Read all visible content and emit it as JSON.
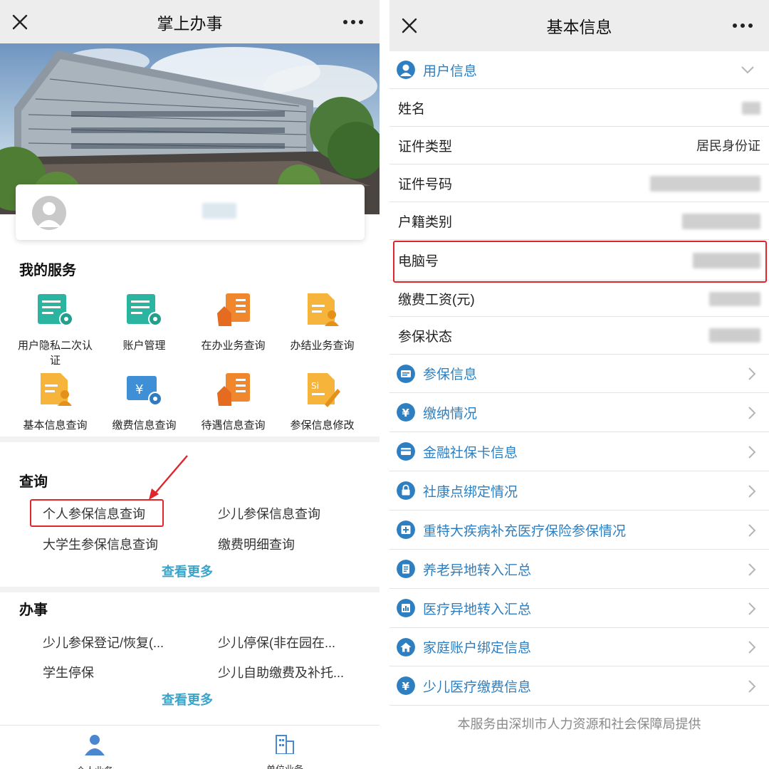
{
  "left": {
    "title": "掌上办事",
    "services_title": "我的服务",
    "services": [
      {
        "label": "用户隐私二次认证",
        "icon": "document-gear-icon"
      },
      {
        "label": "账户管理",
        "icon": "document-gear-icon"
      },
      {
        "label": "在办业务查询",
        "icon": "hand-checklist-icon"
      },
      {
        "label": "办结业务查询",
        "icon": "document-person-icon"
      },
      {
        "label": "基本信息查询",
        "icon": "document-person-icon"
      },
      {
        "label": "缴费信息查询",
        "icon": "yen-card-gear-icon"
      },
      {
        "label": "待遇信息查询",
        "icon": "hand-checklist-icon"
      },
      {
        "label": "参保信息修改",
        "icon": "si-document-pen-icon"
      }
    ],
    "query": {
      "title": "查询",
      "links": [
        "个人参保信息查询",
        "少儿参保信息查询",
        "大学生参保信息查询",
        "缴费明细查询"
      ],
      "more": "查看更多"
    },
    "affairs": {
      "title": "办事",
      "links": [
        "少儿参保登记/恢复(...",
        "少儿停保(非在园在...",
        "学生停保",
        "少儿自助缴费及补托..."
      ],
      "more": "查看更多"
    },
    "tabs": [
      "个人业务",
      "单位业务"
    ]
  },
  "right": {
    "title": "基本信息",
    "user_info_label": "用户信息",
    "fields": [
      {
        "label": "姓名",
        "value": ""
      },
      {
        "label": "证件类型",
        "value": "居民身份证"
      },
      {
        "label": "证件号码",
        "value": ""
      },
      {
        "label": "户籍类别",
        "value": ""
      },
      {
        "label": "电脑号",
        "value": ""
      },
      {
        "label": "缴费工资(元)",
        "value": ""
      },
      {
        "label": "参保状态",
        "value": ""
      }
    ],
    "links": [
      {
        "label": "参保信息",
        "icon": "id-card-icon"
      },
      {
        "label": "缴纳情况",
        "icon": "yen-icon"
      },
      {
        "label": "金融社保卡信息",
        "icon": "card-icon"
      },
      {
        "label": "社康点绑定情况",
        "icon": "lock-icon"
      },
      {
        "label": "重特大疾病补充医疗保险参保情况",
        "icon": "medical-plus-icon"
      },
      {
        "label": "养老异地转入汇总",
        "icon": "document-icon"
      },
      {
        "label": "医疗异地转入汇总",
        "icon": "bar-chart-icon"
      },
      {
        "label": "家庭账户绑定信息",
        "icon": "home-icon"
      },
      {
        "label": "少儿医疗缴费信息",
        "icon": "yen-icon"
      }
    ],
    "footer": "本服务由深圳市人力资源和社会保障局提供"
  },
  "colors": {
    "link_blue": "#2d7fc1",
    "see_more": "#3aa3c8",
    "highlight_red": "#e0252b",
    "icon_teal": "#2bb5a0",
    "icon_orange": "#f0872d",
    "icon_yellow": "#f6b43a"
  }
}
